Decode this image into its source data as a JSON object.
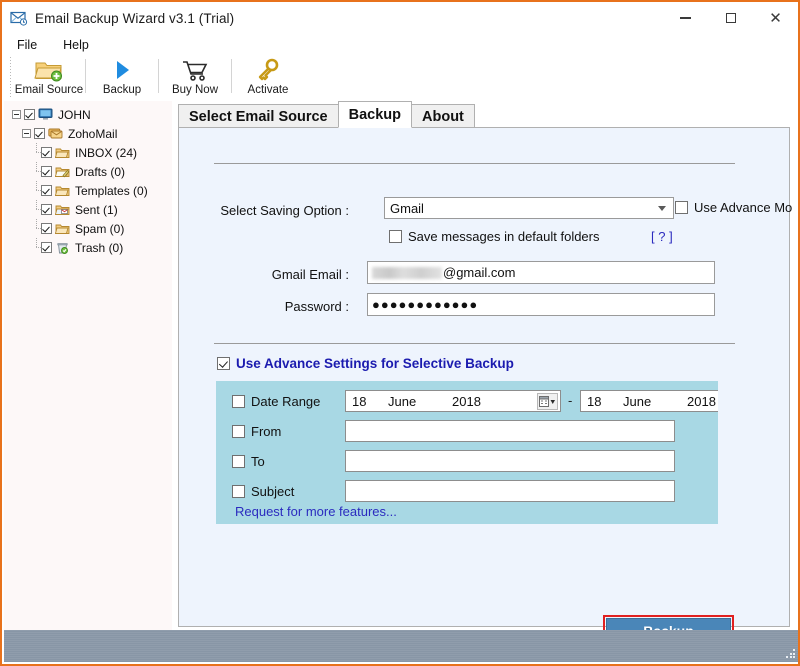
{
  "window": {
    "title": "Email Backup Wizard v3.1 (Trial)",
    "icon": "envelope-icon",
    "controls": {
      "minimize": "–",
      "maximize": "□",
      "close": "✕"
    },
    "accent_border": "#e8721c"
  },
  "menu": {
    "items": [
      {
        "label": "File"
      },
      {
        "label": "Help"
      }
    ]
  },
  "toolbar": {
    "items": [
      {
        "label": "Email Source",
        "icon": "folder-add-icon"
      },
      {
        "label": "Backup",
        "icon": "play-triangle-icon"
      },
      {
        "label": "Buy Now",
        "icon": "shopping-cart-icon"
      },
      {
        "label": "Activate",
        "icon": "key-icon"
      }
    ]
  },
  "tree": {
    "root": {
      "label": "JOHN",
      "icon": "computer-icon",
      "checked": true,
      "expanded": true
    },
    "account": {
      "label": "ZohoMail",
      "icon": "mail-stack-icon",
      "checked": true,
      "expanded": true
    },
    "folders": [
      {
        "label": "INBOX (24)",
        "icon": "inbox-folder-icon",
        "checked": true
      },
      {
        "label": "Drafts (0)",
        "icon": "drafts-folder-icon",
        "checked": true
      },
      {
        "label": "Templates (0)",
        "icon": "templates-folder-icon",
        "checked": true
      },
      {
        "label": "Sent (1)",
        "icon": "sent-folder-icon",
        "checked": true
      },
      {
        "label": "Spam (0)",
        "icon": "spam-folder-icon",
        "checked": true
      },
      {
        "label": "Trash (0)",
        "icon": "trash-folder-icon",
        "checked": true
      }
    ]
  },
  "tabs": [
    {
      "label": "Select Email Source",
      "active": false
    },
    {
      "label": "Backup",
      "active": true
    },
    {
      "label": "About",
      "active": false
    }
  ],
  "form": {
    "saving_option_label": "Select Saving Option :",
    "saving_option_value": "Gmail",
    "use_advance_mode_label": "Use Advance Mo",
    "use_advance_mode_checked": false,
    "save_default_folders_label": "Save messages in default folders",
    "save_default_folders_checked": false,
    "help_marker": "[ ? ]",
    "email_label": "Gmail Email :",
    "email_value_suffix": "@gmail.com",
    "email_value_redacted": true,
    "password_label": "Password :",
    "password_value": "●●●●●●●●●●●●"
  },
  "advance": {
    "title": "Use Advance Settings for Selective Backup",
    "title_checked": true,
    "panel_color": "#a8d8e4",
    "date_range": {
      "label": "Date Range",
      "checked": false,
      "from": {
        "day": "18",
        "month": "June",
        "year": "2018"
      },
      "separator": "-",
      "to": {
        "day": "18",
        "month": "June",
        "year": "2018"
      }
    },
    "filters": [
      {
        "label": "From",
        "checked": false,
        "value": ""
      },
      {
        "label": "To",
        "checked": false,
        "value": ""
      },
      {
        "label": "Subject",
        "checked": false,
        "value": ""
      }
    ],
    "request_link": "Request for more features..."
  },
  "actions": {
    "backup_button": "Backup",
    "backup_highlight_color": "#e02020",
    "backup_button_color": "#4a86b8"
  }
}
